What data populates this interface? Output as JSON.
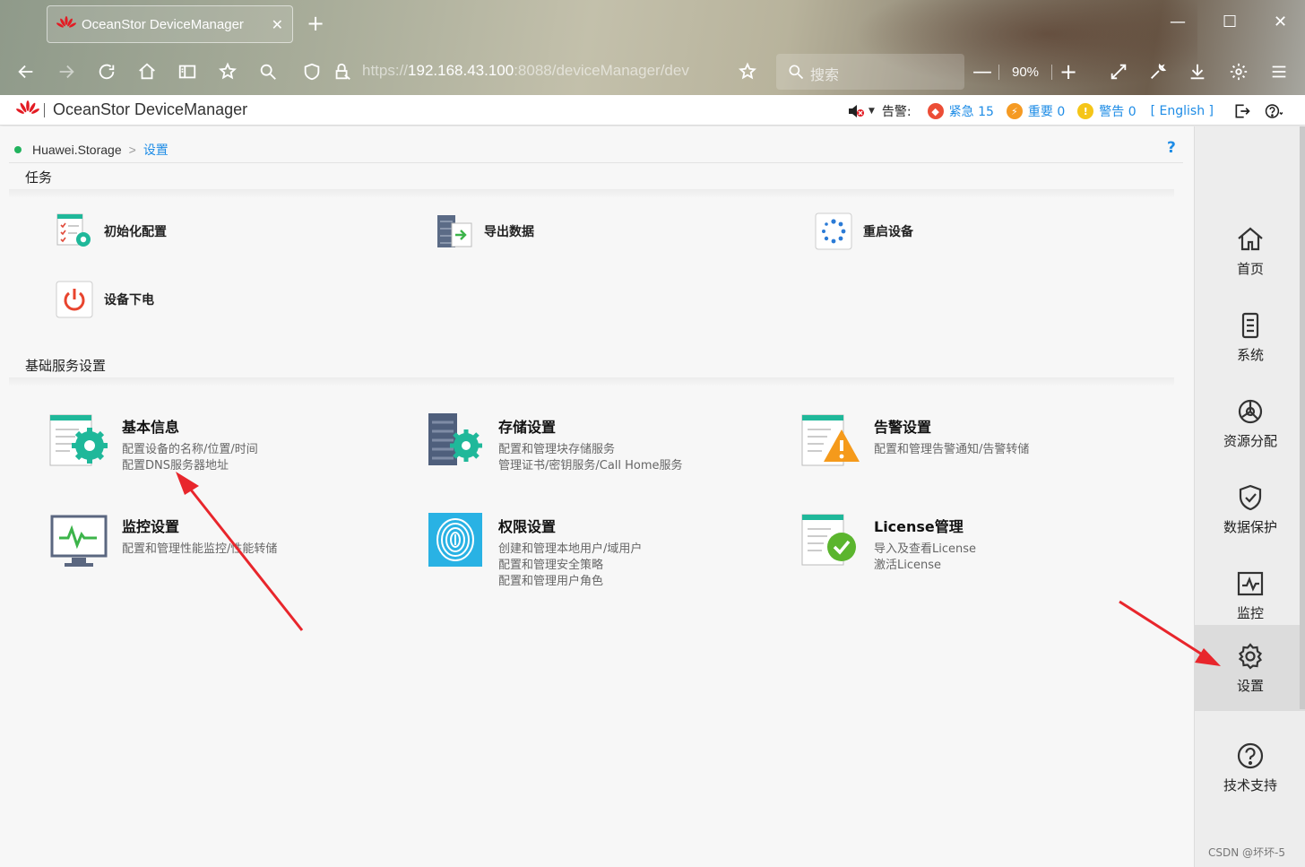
{
  "browser": {
    "tab_title": "OceanStor DeviceManager",
    "tab_close": "✕",
    "new_tab": "+",
    "url_scheme": "https://",
    "url_host": "192.168.43.100",
    "url_rest": ":8088/deviceManager/dev",
    "search_placeholder": "搜索",
    "zoom_minus": "—",
    "zoom_level": "90%",
    "zoom_plus": "+",
    "win_min": "—",
    "win_max": "☐",
    "win_close": "✕"
  },
  "app": {
    "title": "OceanStor DeviceManager",
    "alarm_label": "告警:",
    "alarms": {
      "critical": "紧急 15",
      "major": "重要 0",
      "warning": "警告 0"
    },
    "language": "[ English ]"
  },
  "breadcrumb": {
    "root": "Huawei.Storage",
    "separator": ">",
    "current": "设置",
    "help": "?"
  },
  "tasks": {
    "title": "任务",
    "items": [
      {
        "label": "初始化配置"
      },
      {
        "label": "导出数据"
      },
      {
        "label": "重启设备"
      },
      {
        "label": "设备下电"
      }
    ]
  },
  "basic": {
    "title": "基础服务设置",
    "items": [
      {
        "title": "基本信息",
        "lines": [
          "配置设备的名称/位置/时间",
          "配置DNS服务器地址"
        ]
      },
      {
        "title": "存储设置",
        "lines": [
          "配置和管理块存储服务",
          "管理证书/密钥服务/Call Home服务"
        ]
      },
      {
        "title": "告警设置",
        "lines": [
          "配置和管理告警通知/告警转储"
        ]
      },
      {
        "title": "监控设置",
        "lines": [
          "配置和管理性能监控/性能转储"
        ]
      },
      {
        "title": "权限设置",
        "lines": [
          "创建和管理本地用户/域用户",
          "配置和管理安全策略",
          "配置和管理用户角色"
        ]
      },
      {
        "title": "License管理",
        "lines": [
          "导入及查看License",
          "激活License"
        ]
      }
    ]
  },
  "right_nav": {
    "items": [
      {
        "label": "首页"
      },
      {
        "label": "系统"
      },
      {
        "label": "资源分配"
      },
      {
        "label": "数据保护"
      },
      {
        "label": "监控"
      },
      {
        "label": "设置"
      },
      {
        "label": "技术支持"
      }
    ],
    "active": "设置"
  },
  "watermark": "CSDN @坏坏-5",
  "colors": {
    "accent": "#1e8ce6",
    "critical": "#ec4d36",
    "major": "#f59a23",
    "warning": "#f5c518",
    "status_ok": "#22b35e",
    "arrow": "#e8262c"
  }
}
